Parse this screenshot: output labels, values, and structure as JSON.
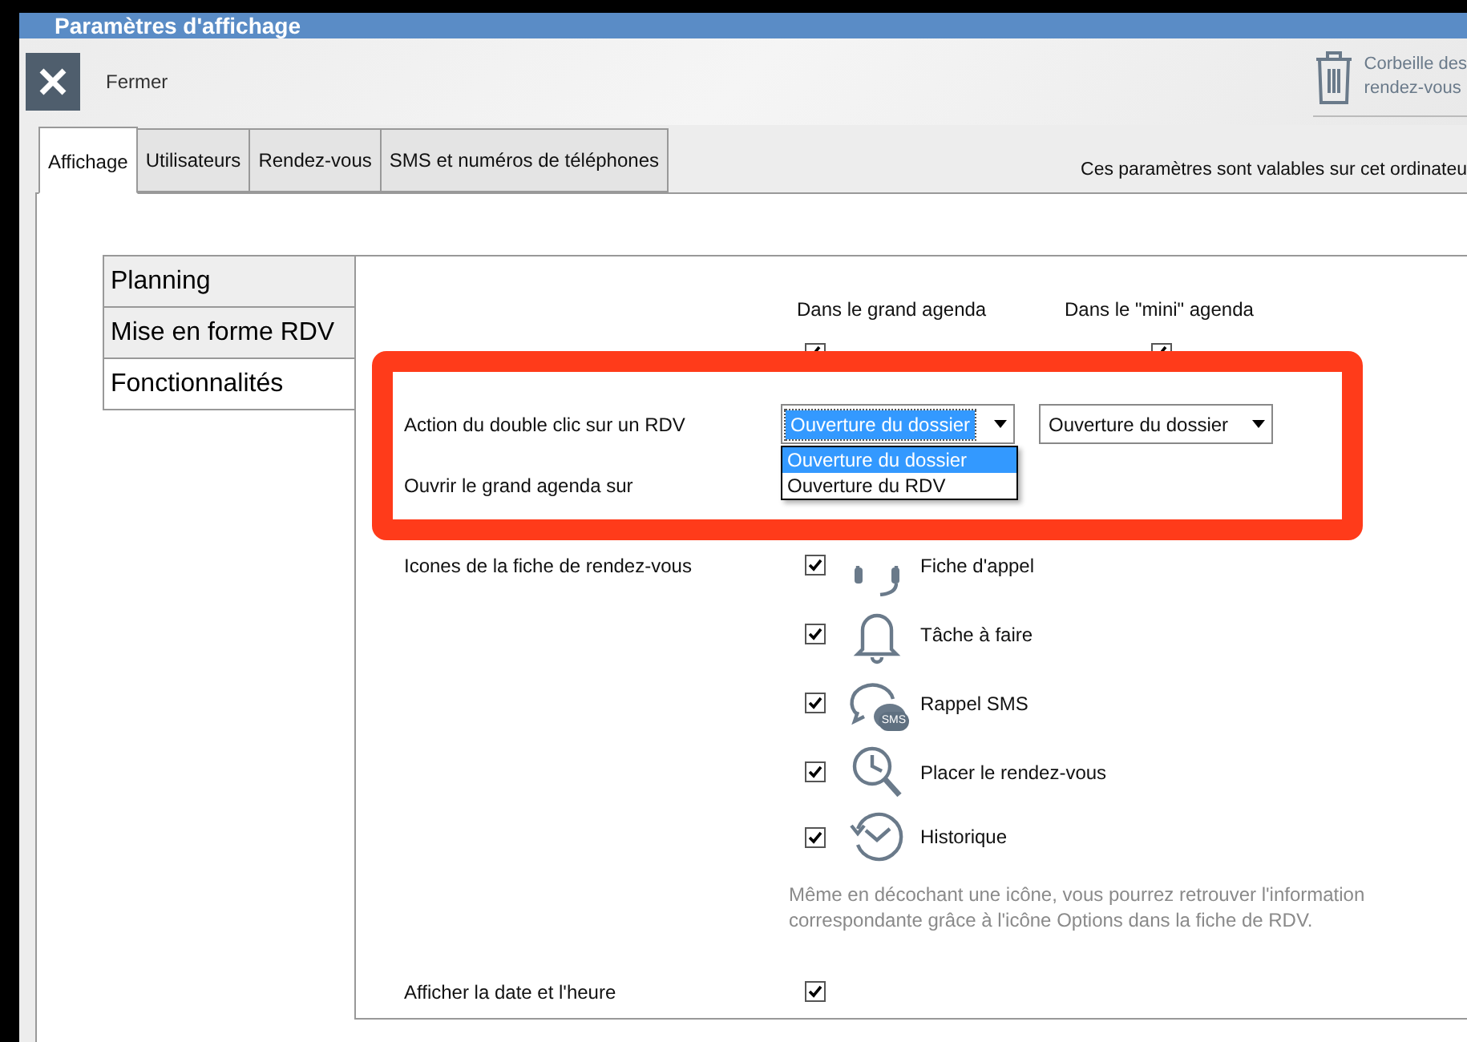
{
  "window": {
    "title": "Paramètres d'affichage"
  },
  "toolbar": {
    "close_label": "Fermer",
    "trash_lines": [
      "Corbeille des",
      "rendez-vous"
    ]
  },
  "tabs": [
    {
      "label": "Affichage",
      "selected": true
    },
    {
      "label": "Utilisateurs",
      "selected": false
    },
    {
      "label": "Rendez-vous",
      "selected": false
    },
    {
      "label": "SMS et numéros de téléphones",
      "selected": false
    }
  ],
  "scope_note": "Ces paramètres sont valables sur cet ordinateu",
  "sections": [
    {
      "label": "Planning",
      "selected": false
    },
    {
      "label": "Mise en forme RDV",
      "selected": false
    },
    {
      "label": "Fonctionnalités",
      "selected": true
    }
  ],
  "columns": [
    "Dans le grand agenda",
    "Dans le \"mini\" agenda"
  ],
  "settings": [
    {
      "kind": "checks",
      "checked": [
        true,
        true
      ]
    },
    {
      "kind": "select",
      "label": "Action du double clic sur un RDV",
      "selects": [
        {
          "value": "Ouverture du dossier",
          "focused": true,
          "options": [
            {
              "label": "Ouverture du dossier",
              "selected": true
            },
            {
              "label": "Ouverture du RDV",
              "selected": false
            }
          ]
        },
        {
          "value": "Ouverture du dossier",
          "focused": false
        }
      ]
    },
    {
      "kind": "blank",
      "label": "Ouvrir le grand agenda sur"
    },
    {
      "kind": "icons",
      "label": "Icones de la fiche de rendez-vous",
      "items": [
        {
          "kind": "headset",
          "label": "Fiche d'appel",
          "checked": true
        },
        {
          "kind": "bell",
          "label": "Tâche à faire",
          "checked": true
        },
        {
          "kind": "sms",
          "label": "Rappel SMS",
          "checked": true,
          "badge": "SMS"
        },
        {
          "kind": "search",
          "label": "Placer le rendez-vous",
          "checked": true
        },
        {
          "kind": "history",
          "label": "Historique",
          "checked": true
        }
      ],
      "note": "Même en décochant une icône, vous pourrez retrouver l'information correspondante grâce à l'icône Options dans la fiche de RDV."
    },
    {
      "kind": "checks",
      "label": "Afficher la date et l'heure",
      "checked": [
        true
      ]
    }
  ],
  "highlight_frame": true
}
